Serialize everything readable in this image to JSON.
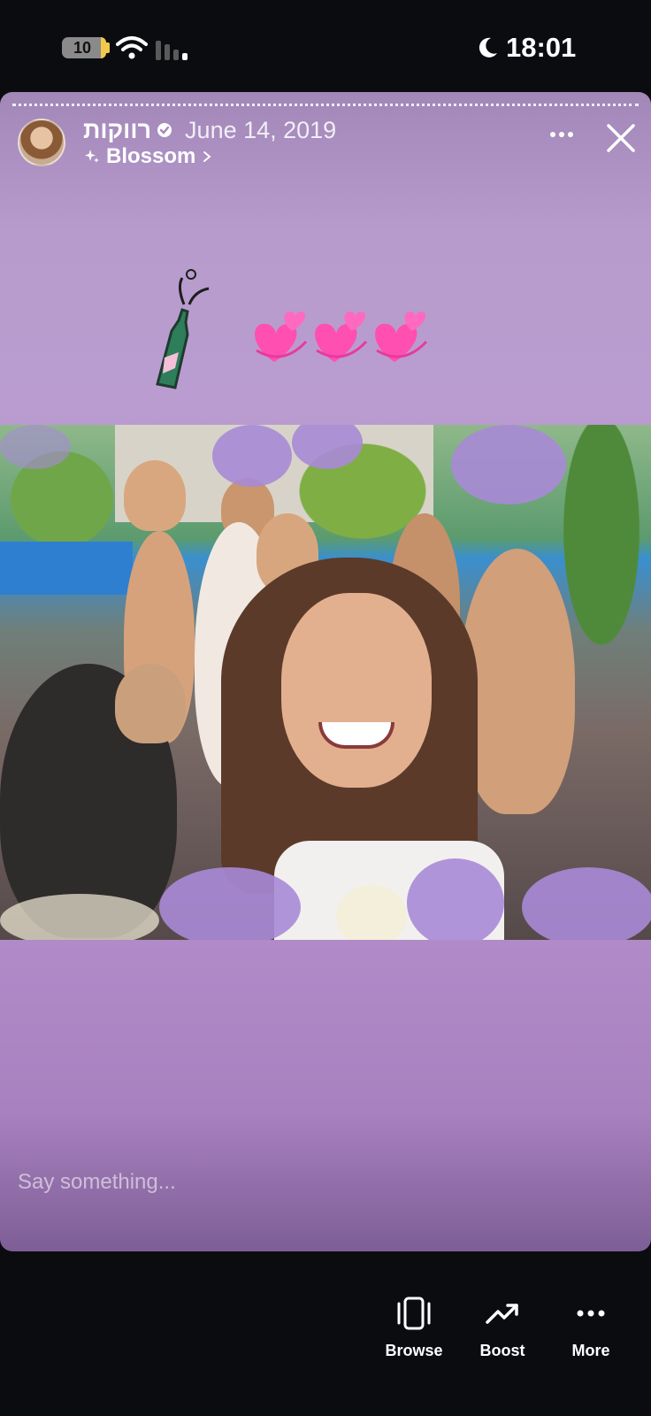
{
  "status_bar": {
    "battery": "10",
    "time": "18:01",
    "icons": [
      "battery-icon",
      "wifi-icon",
      "cellular-signal-icon",
      "moon-icon"
    ]
  },
  "story": {
    "username": "רווקות",
    "date": "June 14, 2019",
    "effect_name": "Blossom",
    "comment_placeholder": "Say something...",
    "stickers": [
      "champagne-bottle-sticker",
      "heart-sticker",
      "heart-sticker",
      "heart-sticker"
    ],
    "icons": [
      "verified-icon",
      "sparkles-icon",
      "chevron-right-icon",
      "more-icon",
      "close-icon"
    ]
  },
  "bottom_bar": {
    "browse": "Browse",
    "boost": "Boost",
    "more": "More"
  },
  "colors": {
    "background": "#0a0c10",
    "story_purple": "#b592cd",
    "heart_pink": "#ff4fb0"
  }
}
